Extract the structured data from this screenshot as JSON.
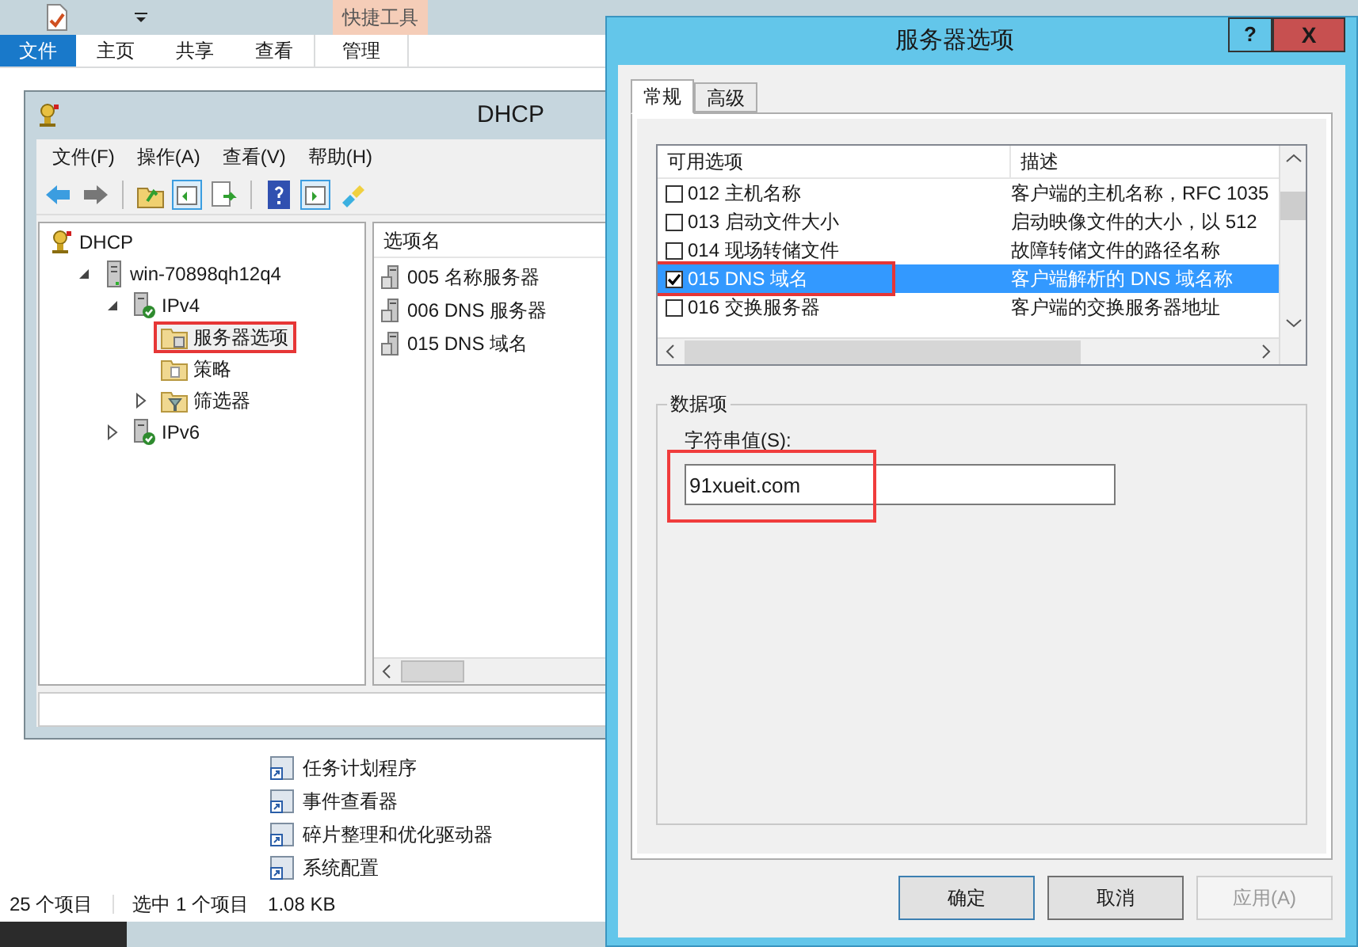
{
  "explorer": {
    "contextual_tab": "快捷工具",
    "file_tab": "文件",
    "ribbon_tabs": [
      {
        "label": "主页",
        "contextual": false
      },
      {
        "label": "共享",
        "contextual": false
      },
      {
        "label": "查看",
        "contextual": false
      },
      {
        "label": "管理",
        "contextual": true
      }
    ],
    "files": [
      "任务计划程序",
      "事件查看器",
      "碎片整理和优化驱动器",
      "系统配置"
    ],
    "status": [
      "25 个项目",
      "选中 1 个项目",
      "1.08 KB"
    ]
  },
  "dhcp": {
    "title": "DHCP",
    "menu": [
      "文件(F)",
      "操作(A)",
      "查看(V)",
      "帮助(H)"
    ],
    "tree": [
      {
        "label": "DHCP",
        "kind": "dhcp",
        "highlighted": false,
        "children": [
          {
            "label": "win-70898qh12q4",
            "kind": "server",
            "expanded": true,
            "highlighted": false,
            "children": [
              {
                "label": "IPv4",
                "kind": "ip",
                "expanded": true,
                "highlighted": false,
                "children": [
                  {
                    "label": "服务器选项",
                    "kind": "options",
                    "highlighted": true
                  },
                  {
                    "label": "策略",
                    "kind": "policy",
                    "highlighted": false
                  },
                  {
                    "label": "筛选器",
                    "kind": "filter",
                    "expanded": false,
                    "highlighted": false
                  }
                ]
              },
              {
                "label": "IPv6",
                "kind": "ip",
                "expanded": false,
                "highlighted": false
              }
            ]
          }
        ]
      }
    ],
    "list_header": "选项名",
    "list_items": [
      "005 名称服务器",
      "006 DNS 服务器",
      "015 DNS 域名"
    ]
  },
  "dialog": {
    "title": "服务器选项",
    "help_button": "?",
    "close_button": "X",
    "tabs": [
      {
        "label": "常规",
        "selected": true
      },
      {
        "label": "高级",
        "selected": false
      }
    ],
    "columns": [
      "可用选项",
      "描述"
    ],
    "options": [
      {
        "name": "012 主机名称",
        "description": "客户端的主机名称，RFC 1035",
        "checked": false,
        "selected": false,
        "highlighted": false
      },
      {
        "name": "013 启动文件大小",
        "description": "启动映像文件的大小，以 512",
        "checked": false,
        "selected": false,
        "highlighted": false
      },
      {
        "name": "014 现场转储文件",
        "description": "故障转储文件的路径名称",
        "checked": false,
        "selected": false,
        "highlighted": false
      },
      {
        "name": "015 DNS 域名",
        "description": "客户端解析的 DNS 域名称",
        "checked": true,
        "selected": true,
        "highlighted": true
      },
      {
        "name": "016 交换服务器",
        "description": "客户端的交换服务器地址",
        "checked": false,
        "selected": false,
        "highlighted": false
      }
    ],
    "group_title": "数据项",
    "field_label": "字符串值(S):",
    "field_value": "91xueit.com",
    "field_highlighted": true,
    "buttons": [
      {
        "label": "确定",
        "disabled": false,
        "default": true
      },
      {
        "label": "取消",
        "disabled": false,
        "default": false
      },
      {
        "label": "应用(A)",
        "disabled": true,
        "default": false
      }
    ]
  }
}
